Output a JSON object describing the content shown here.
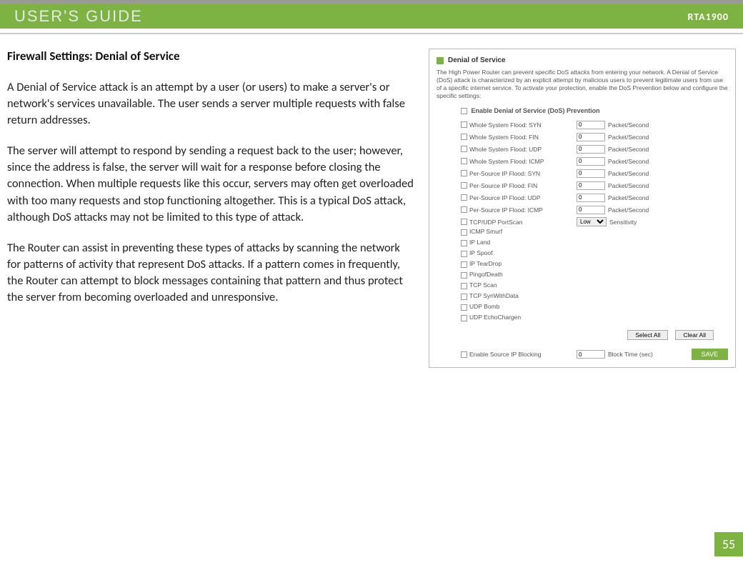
{
  "header": {
    "title": "USER'S GUIDE",
    "model": "RTA1900"
  },
  "page": {
    "heading": "Firewall Settings: Denial of Service",
    "para1": "A Denial of Service attack is an attempt by a user (or users) to make a server's or network's services unavailable. The user sends a server multiple requests with false return addresses.",
    "para2": "The server will attempt to respond by sending a request back to the user; however, since the address is false, the server will wait for a response before closing the connection. When multiple requests like this occur, servers may often get overloaded with too many requests and stop functioning altogether. This is a typical DoS attack, although DoS attacks may not be limited to this type of attack.",
    "para3": "The Router can assist in preventing these types of attacks by scanning the network for patterns of activity that represent DoS attacks. If a pattern comes in frequently, the Router can attempt to block messages containing that pattern and thus protect the server from becoming overloaded and unresponsive.",
    "number": "55"
  },
  "shot": {
    "title": "Denial of Service",
    "desc": "The High Power Router can prevent specific DoS attacks from entering your network. A Denial of Service (DoS) attack is characterized by an explicit attempt by malicious users to prevent legitimate users from use of a specific internet service. To activate your protection, enable the DoS Prevention below and configure the specific settings:",
    "enable_label": "Enable Denial of Service (DoS) Prevention",
    "rate_options": [
      {
        "label": "Whole System Flood: SYN",
        "value": "0",
        "unit": "Packet/Second"
      },
      {
        "label": "Whole System Flood: FIN",
        "value": "0",
        "unit": "Packet/Second"
      },
      {
        "label": "Whole System Flood: UDP",
        "value": "0",
        "unit": "Packet/Second"
      },
      {
        "label": "Whole System Flood: ICMP",
        "value": "0",
        "unit": "Packet/Second"
      },
      {
        "label": "Per-Source IP Flood: SYN",
        "value": "0",
        "unit": "Packet/Second"
      },
      {
        "label": "Per-Source IP Flood: FIN",
        "value": "0",
        "unit": "Packet/Second"
      },
      {
        "label": "Per-Source IP Flood: UDP",
        "value": "0",
        "unit": "Packet/Second"
      },
      {
        "label": "Per-Source IP Flood: ICMP",
        "value": "0",
        "unit": "Packet/Second"
      }
    ],
    "portscan_label": "TCP/UDP PortScan",
    "portscan_sens": "Low",
    "portscan_unit": "Sensitivity",
    "simple_options": [
      "ICMP Smurf",
      "IP Land",
      "IP Spoof",
      "IP TearDrop",
      "PingofDeath",
      "TCP Scan",
      "TCP SynWithData",
      "UDP Bomb",
      "UDP EchoChargen"
    ],
    "select_all": "Select All",
    "clear_all": "Clear All",
    "source_block_label": "Enable Source IP Blocking",
    "source_block_value": "0",
    "source_block_unit": "Block Time (sec)",
    "save": "SAVE"
  }
}
